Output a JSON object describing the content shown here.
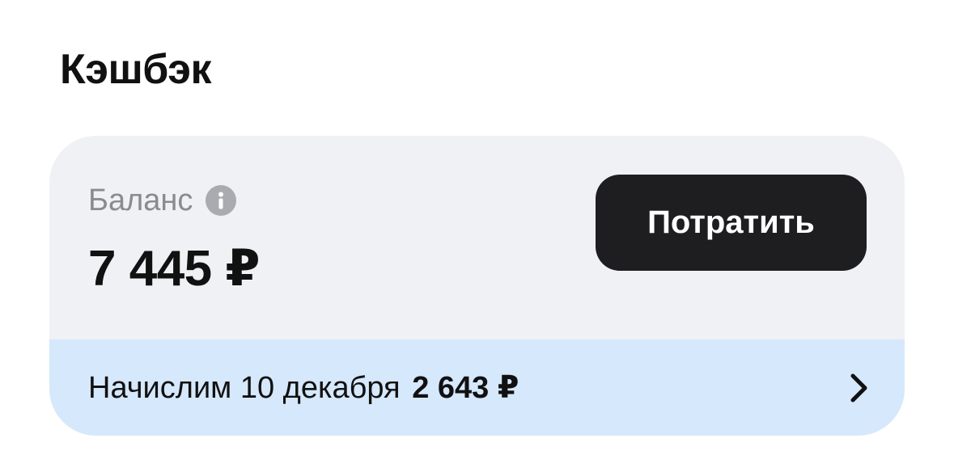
{
  "section": {
    "title": "Кэшбэк"
  },
  "balance": {
    "label": "Баланс",
    "amount": "7 445 ₽",
    "info_icon": "info-icon"
  },
  "actions": {
    "spend_label": "Потратить"
  },
  "accrual": {
    "text": "Начислим 10 декабря",
    "amount": "2 643 ₽",
    "chevron_icon": "chevron-right-icon"
  },
  "colors": {
    "card_background": "#f0f1f4",
    "accrual_background": "#d6e8fb",
    "button_background": "#1e1e20",
    "button_text": "#ffffff",
    "muted_text": "#8a8b90"
  }
}
